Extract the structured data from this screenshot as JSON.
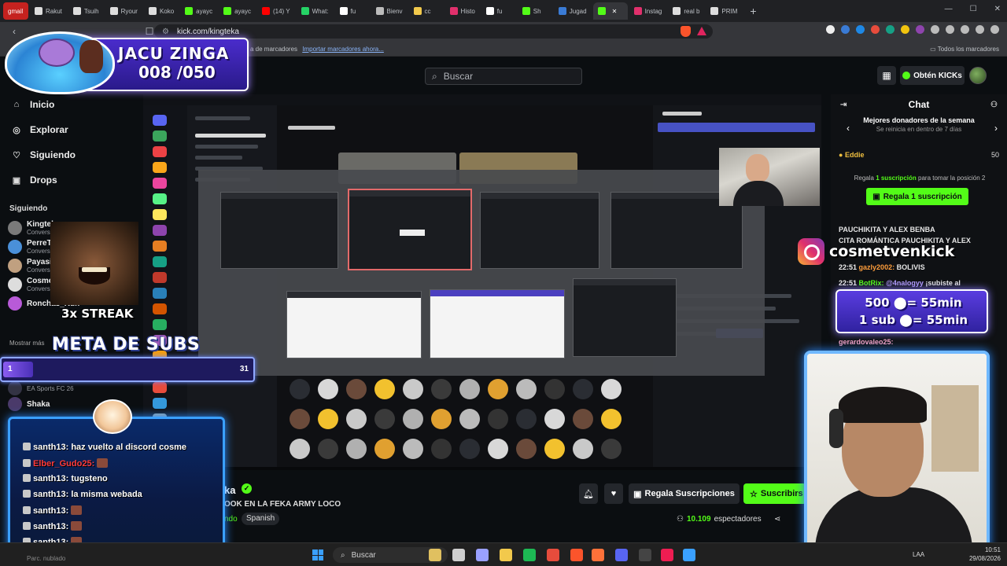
{
  "browser": {
    "tabs": [
      {
        "label": "gmail",
        "color": "#c5221f",
        "kind": "gmail"
      },
      {
        "label": "Rakut",
        "color": "#dddddd"
      },
      {
        "label": "Tsuih",
        "color": "#dddddd"
      },
      {
        "label": "Ryour",
        "color": "#dddddd"
      },
      {
        "label": "Koko",
        "color": "#dddddd"
      },
      {
        "label": "ayayc",
        "color": "#53fc18"
      },
      {
        "label": "ayayc",
        "color": "#53fc18"
      },
      {
        "label": "(14) Y",
        "color": "#ff0000"
      },
      {
        "label": "What:",
        "color": "#25d366"
      },
      {
        "label": "fu",
        "color": "#ffffff"
      },
      {
        "label": "Bienv",
        "color": "#bbbbbb"
      },
      {
        "label": "cc",
        "color": "#f2c94c"
      },
      {
        "label": "Histo",
        "color": "#e1306c"
      },
      {
        "label": "fu",
        "color": "#ffffff"
      },
      {
        "label": "Sh",
        "color": "#53fc18"
      },
      {
        "label": "Jugad",
        "color": "#3a7bd5"
      },
      {
        "label": "",
        "color": "#53fc18",
        "active": true
      },
      {
        "label": "Instag",
        "color": "#e1306c"
      },
      {
        "label": "real b",
        "color": "#dddddd"
      },
      {
        "label": "PRIM",
        "color": "#dddddd"
      }
    ],
    "url": "kick.com/kingteka",
    "bookmarks_text": "a de marcadores",
    "bookmarks_link": "Importar marcadores ahora...",
    "bookmarks_right": "Todos los marcadores"
  },
  "header": {
    "search_placeholder": "Buscar",
    "kicks_label": "Obtén KICKs"
  },
  "sidebar": {
    "nav": [
      {
        "label": "Inicio",
        "icon": "home-icon",
        "glyph": "⌂"
      },
      {
        "label": "Explorar",
        "icon": "compass-icon",
        "glyph": "◎"
      },
      {
        "label": "Siguiendo",
        "icon": "heart-icon",
        "glyph": "♡"
      },
      {
        "label": "Drops",
        "icon": "gift-icon",
        "glyph": "▣"
      }
    ],
    "following_title": "Siguiendo",
    "following": [
      {
        "name": "Kingtek",
        "sub": "Convers",
        "color": "#7a7a7a"
      },
      {
        "name": "PerreTV",
        "sub": "Convers",
        "color": "#4a90d9"
      },
      {
        "name": "Payasit",
        "sub": "Convers",
        "color": "#c0a080"
      },
      {
        "name": "CosmeT",
        "sub": "Conversando",
        "color": "#dddddd"
      },
      {
        "name": "Ronchas_Kun",
        "sub": "",
        "color": "#b85ad8"
      }
    ],
    "show_more": "Mostrar más",
    "extra_item": "EA Sports FC 26",
    "extra_item2": "Shaka"
  },
  "stream": {
    "title_fragment": "ka",
    "subtitle": "OOK EN LA FEKA ARMY LOCO",
    "category_fragment": "ndo",
    "language": "Spanish",
    "gift_label": "Regala Suscripciones",
    "subscribe_label": "Suscribirs",
    "viewers": "10.109",
    "viewers_label": "espectadores"
  },
  "chat": {
    "title": "Chat",
    "donors_title": "Mejores donadores de la semana",
    "donors_sub": "Se reinicia en dentro de 7 días",
    "top_donor": "Eddie",
    "top_donor_value": "50",
    "gift_info_pre": "Regala",
    "gift_info_bold": "1 suscripción",
    "gift_info_post": "para tomar la posición 2",
    "gift_one_label": "Regala 1 suscripción",
    "lines": [
      "PAUCHIKITA Y ALEX BENBA",
      "CITA ROMÁNTICA PAUCHIKITA Y ALEX"
    ],
    "msg1_time": "22:51",
    "msg1_user": "gazly2002:",
    "msg1_text": "BOLIVIS",
    "msg2_time": "22:51",
    "msg2_user": "BotRix:",
    "msg2_mention": "@4nalogyy",
    "msg2_text": "¡subiste al"
  },
  "overlays": {
    "jacu_title": "JACU ZINGA",
    "jacu_count": "008 /050",
    "streak": "3x STREAK",
    "meta_title": "META DE SUBS",
    "meta_left": "1",
    "meta_right": "31",
    "meta_progress": 0.032,
    "ig_handle": "cosmetvenkick",
    "goal_line1": "500 ⬤= 55min",
    "goal_line2": "1 sub ⬤= 55min",
    "cam_chat_user": "gerardovaleo25:",
    "overlay_chat": [
      {
        "user": "santh13:",
        "text": "haz vuelto al discord cosme",
        "red": false
      },
      {
        "user": "Elber_Gudo25:",
        "text": "",
        "red": true
      },
      {
        "user": "santh13:",
        "text": "tugsteno",
        "red": false
      },
      {
        "user": "santh13:",
        "text": "la misma webada",
        "red": false
      },
      {
        "user": "santh13:",
        "text": "",
        "red": false
      },
      {
        "user": "santh13:",
        "text": "",
        "red": false
      },
      {
        "user": "santh13:",
        "text": "",
        "red": false
      }
    ]
  },
  "taskbar": {
    "search_placeholder": "Buscar",
    "lang": "LAA",
    "time": "10:51",
    "date": "29/08/2026",
    "status": "Parc. nublado"
  }
}
